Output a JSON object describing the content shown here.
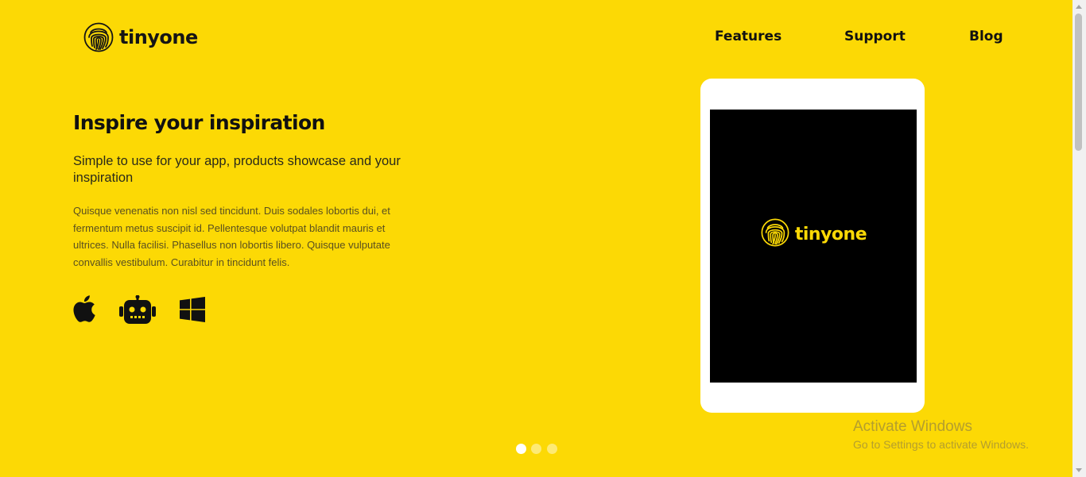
{
  "brand": {
    "name": "tinyone",
    "logo_icon": "fingerprint-icon",
    "accent_color": "#FCD905",
    "text_color": "#111111"
  },
  "nav": {
    "items": [
      {
        "label": "Features"
      },
      {
        "label": "Support"
      },
      {
        "label": "Blog"
      }
    ]
  },
  "hero": {
    "title": "Inspire your inspiration",
    "subtitle": "Simple to use for your app, products showcase and your inspiration",
    "body": "Quisque venenatis non nisl sed tincidunt. Duis sodales lobortis dui, et fermentum metus suscipit id. Pellentesque volutpat blandit mauris et ultrices. Nulla facilisi. Phasellus non lobortis libero. Quisque vulputate convallis vestibulum. Curabitur in tincidunt felis.",
    "platforms": [
      {
        "icon": "apple-icon"
      },
      {
        "icon": "android-robot-icon"
      },
      {
        "icon": "windows-icon"
      }
    ]
  },
  "device": {
    "type": "tablet",
    "screen_brand": "tinyone",
    "screen_color": "#000000",
    "frame_color": "#ffffff"
  },
  "carousel": {
    "slide_count": 3,
    "active_index": 0
  },
  "watermark": {
    "title": "Activate Windows",
    "subtitle": "Go to Settings to activate Windows."
  }
}
